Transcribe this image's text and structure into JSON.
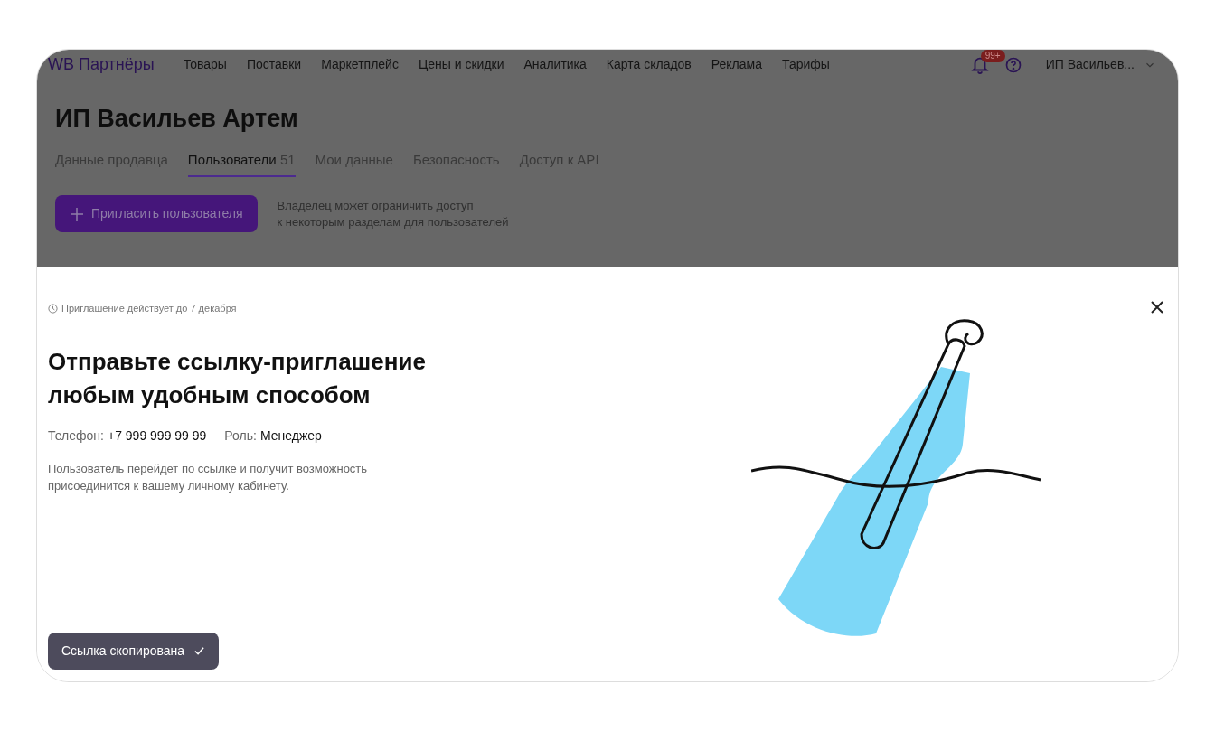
{
  "header": {
    "logo": "WB Партнёры",
    "nav": [
      "Товары",
      "Поставки",
      "Маркетплейс",
      "Цены и скидки",
      "Аналитика",
      "Карта складов",
      "Реклама",
      "Тарифы"
    ],
    "notifications_badge": "99+",
    "account": "ИП Васильев..."
  },
  "page": {
    "title": "ИП Васильев Артем",
    "tabs": [
      {
        "label": "Данные продавца",
        "selected": false
      },
      {
        "label": "Пользователи",
        "count": "51",
        "selected": true
      },
      {
        "label": "Мои данные",
        "selected": false
      },
      {
        "label": "Безопасность",
        "selected": false
      },
      {
        "label": "Доступ к API",
        "selected": false
      }
    ],
    "invite_button": "Пригласить пользователя",
    "hint": [
      "Владелец может ограничить доступ",
      "к некоторым разделам для пользователей"
    ]
  },
  "modal": {
    "validity": "Приглашение действует до 7 декабря",
    "title": [
      "Отправьте ссылку-приглашение",
      "любым удобным способом"
    ],
    "details": [
      {
        "label": "Телефон:",
        "value": "+7 999 999 99 99"
      },
      {
        "label": "Роль:",
        "value": "Менеджер"
      }
    ],
    "description": [
      "Пользователь перейдет по ссылке и получит возможность",
      "присоединится к вашему личному кабинету."
    ],
    "toast": "Ссылка скопирована"
  }
}
